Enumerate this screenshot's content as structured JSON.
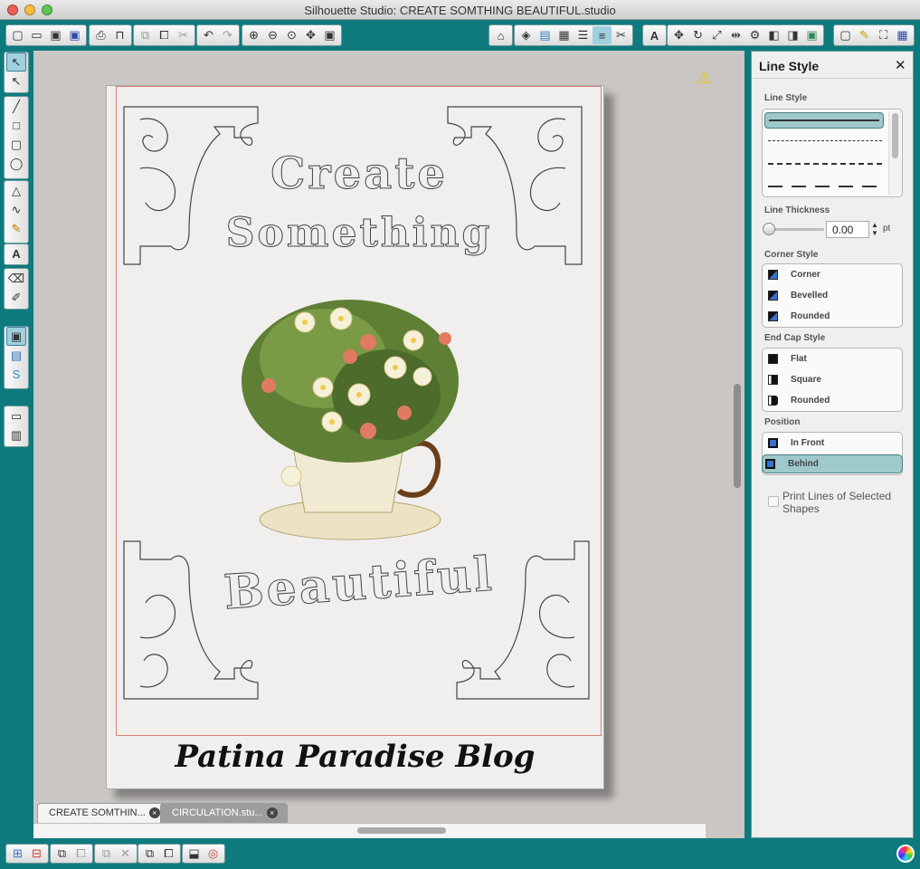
{
  "window": {
    "title": "Silhouette Studio: CREATE SOMTHING BEAUTIFUL.studio"
  },
  "toolbar": {
    "groups": [
      {
        "icons": [
          "new-document-icon",
          "open-icon",
          "save-icon",
          "save-library-icon"
        ]
      },
      {
        "icons": [
          "print-icon",
          "cutter-icon"
        ]
      },
      {
        "icons": [
          "copy-icon",
          "paste-icon",
          "cut-icon"
        ]
      },
      {
        "icons": [
          "undo-icon",
          "redo-icon"
        ]
      },
      {
        "icons": [
          "zoom-in-icon",
          "zoom-out-icon",
          "zoom-selection-icon",
          "pan-icon",
          "fit-page-icon"
        ]
      }
    ]
  },
  "canvas": {
    "design_line1": "Create",
    "design_line2": "Something",
    "design_line3": "Beautiful",
    "blog_text": "Patina Paradise Blog",
    "warning_icon": "⚠",
    "warning_color": "#e8c800"
  },
  "tabs": [
    {
      "label": "CREATE SOMTHIN...",
      "active": true
    },
    {
      "label": "CIRCULATION.stu...",
      "active": false
    }
  ],
  "tab_close_glyph": "×",
  "panel": {
    "title": "Line Style",
    "close_glyph": "✕",
    "line_style_label": "Line Style",
    "line_thickness_label": "Line Thickness",
    "line_thickness_value": "0.00",
    "line_thickness_unit": "pt",
    "corner_style_label": "Corner Style",
    "corner_options": [
      "Corner",
      "Bevelled",
      "Rounded"
    ],
    "end_cap_label": "End Cap Style",
    "end_cap_options": [
      "Flat",
      "Square",
      "Rounded"
    ],
    "position_label": "Position",
    "position_options": [
      "In Front",
      "Behind"
    ],
    "position_selected": "Behind",
    "print_lines_label": "Print Lines of Selected Shapes",
    "print_lines_checked": false
  },
  "colors": {
    "chrome": "#0e7a7e",
    "selection": "#9ec9cb",
    "cut_line": "#d98070"
  }
}
